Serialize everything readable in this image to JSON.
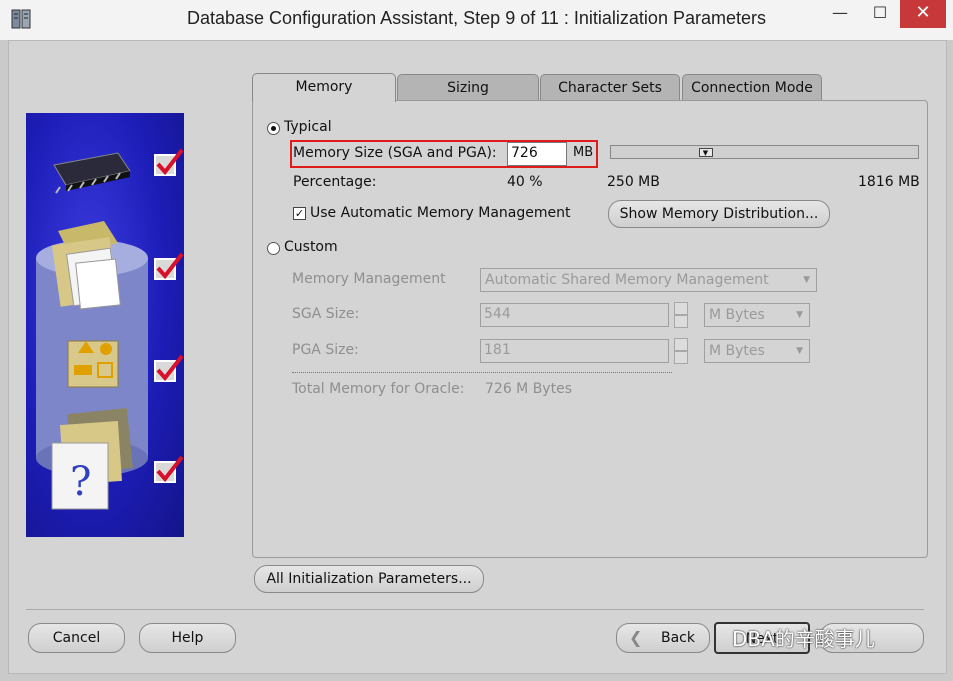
{
  "window": {
    "title": "Database Configuration Assistant, Step 9 of 11 : Initialization Parameters",
    "min": "—",
    "max": "☐",
    "close": "✕"
  },
  "tabs": [
    "Memory",
    "Sizing",
    "Character Sets",
    "Connection Mode"
  ],
  "typical": {
    "label": "Typical",
    "memory_size_label": "Memory Size (SGA and PGA):",
    "memory_size_value": "726",
    "memory_unit": "MB",
    "percentage_label": "Percentage:",
    "percentage_value": "40 %",
    "slider_min": "250 MB",
    "slider_max": "1816 MB",
    "slider_level": 0.3,
    "amm_label": "Use Automatic Memory Management",
    "amm_checked": true,
    "show_dist_button": "Show Memory Distribution..."
  },
  "custom": {
    "label": "Custom",
    "mem_mgmt_label": "Memory Management",
    "mem_mgmt_value": "Automatic Shared Memory Management",
    "sga_label": "SGA Size:",
    "sga_value": "544",
    "sga_unit": "M Bytes",
    "pga_label": "PGA Size:",
    "pga_value": "181",
    "pga_unit": "M Bytes",
    "total_label": "Total Memory for Oracle:",
    "total_value": "726 M Bytes"
  },
  "buttons": {
    "all_params": "All Initialization Parameters...",
    "cancel": "Cancel",
    "help": "Help",
    "back": "Back",
    "next": "Next"
  },
  "watermark": "DBA的辛酸事儿"
}
